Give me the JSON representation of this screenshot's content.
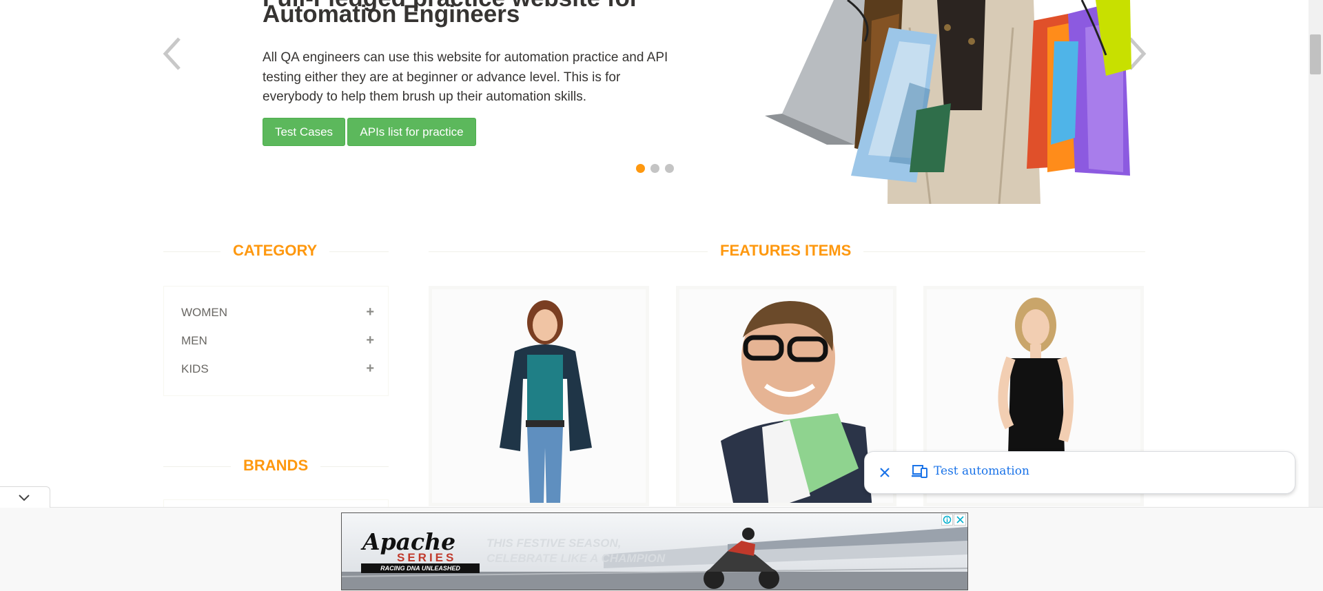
{
  "slider": {
    "title_partial": "Full-Fledged practice website for",
    "title": "Automation Engineers",
    "description": "All QA engineers can use this website for automation practice and API testing either they are at beginner or advance level. This is for everybody to help them brush up their automation skills.",
    "buttons": [
      "Test Cases",
      "APIs list for practice"
    ],
    "active_dot": 1,
    "dot_count": 3
  },
  "category": {
    "title": "CATEGORY",
    "items": [
      {
        "label": "WOMEN"
      },
      {
        "label": "MEN"
      },
      {
        "label": "KIDS"
      }
    ]
  },
  "brands": {
    "title": "BRANDS"
  },
  "features": {
    "title": "FEATURES ITEMS"
  },
  "popup": {
    "label": "Test automation"
  },
  "ad": {
    "brand": "Apache",
    "series": "SERIES",
    "tagline": "RACING DNA UNLEASHED",
    "headline": "THIS FESTIVE SEASON, CELEBRATE LIKE A CHAMPION"
  },
  "colors": {
    "accent": "#FE980F",
    "button": "#5cb85c",
    "link": "#1a73e8"
  }
}
